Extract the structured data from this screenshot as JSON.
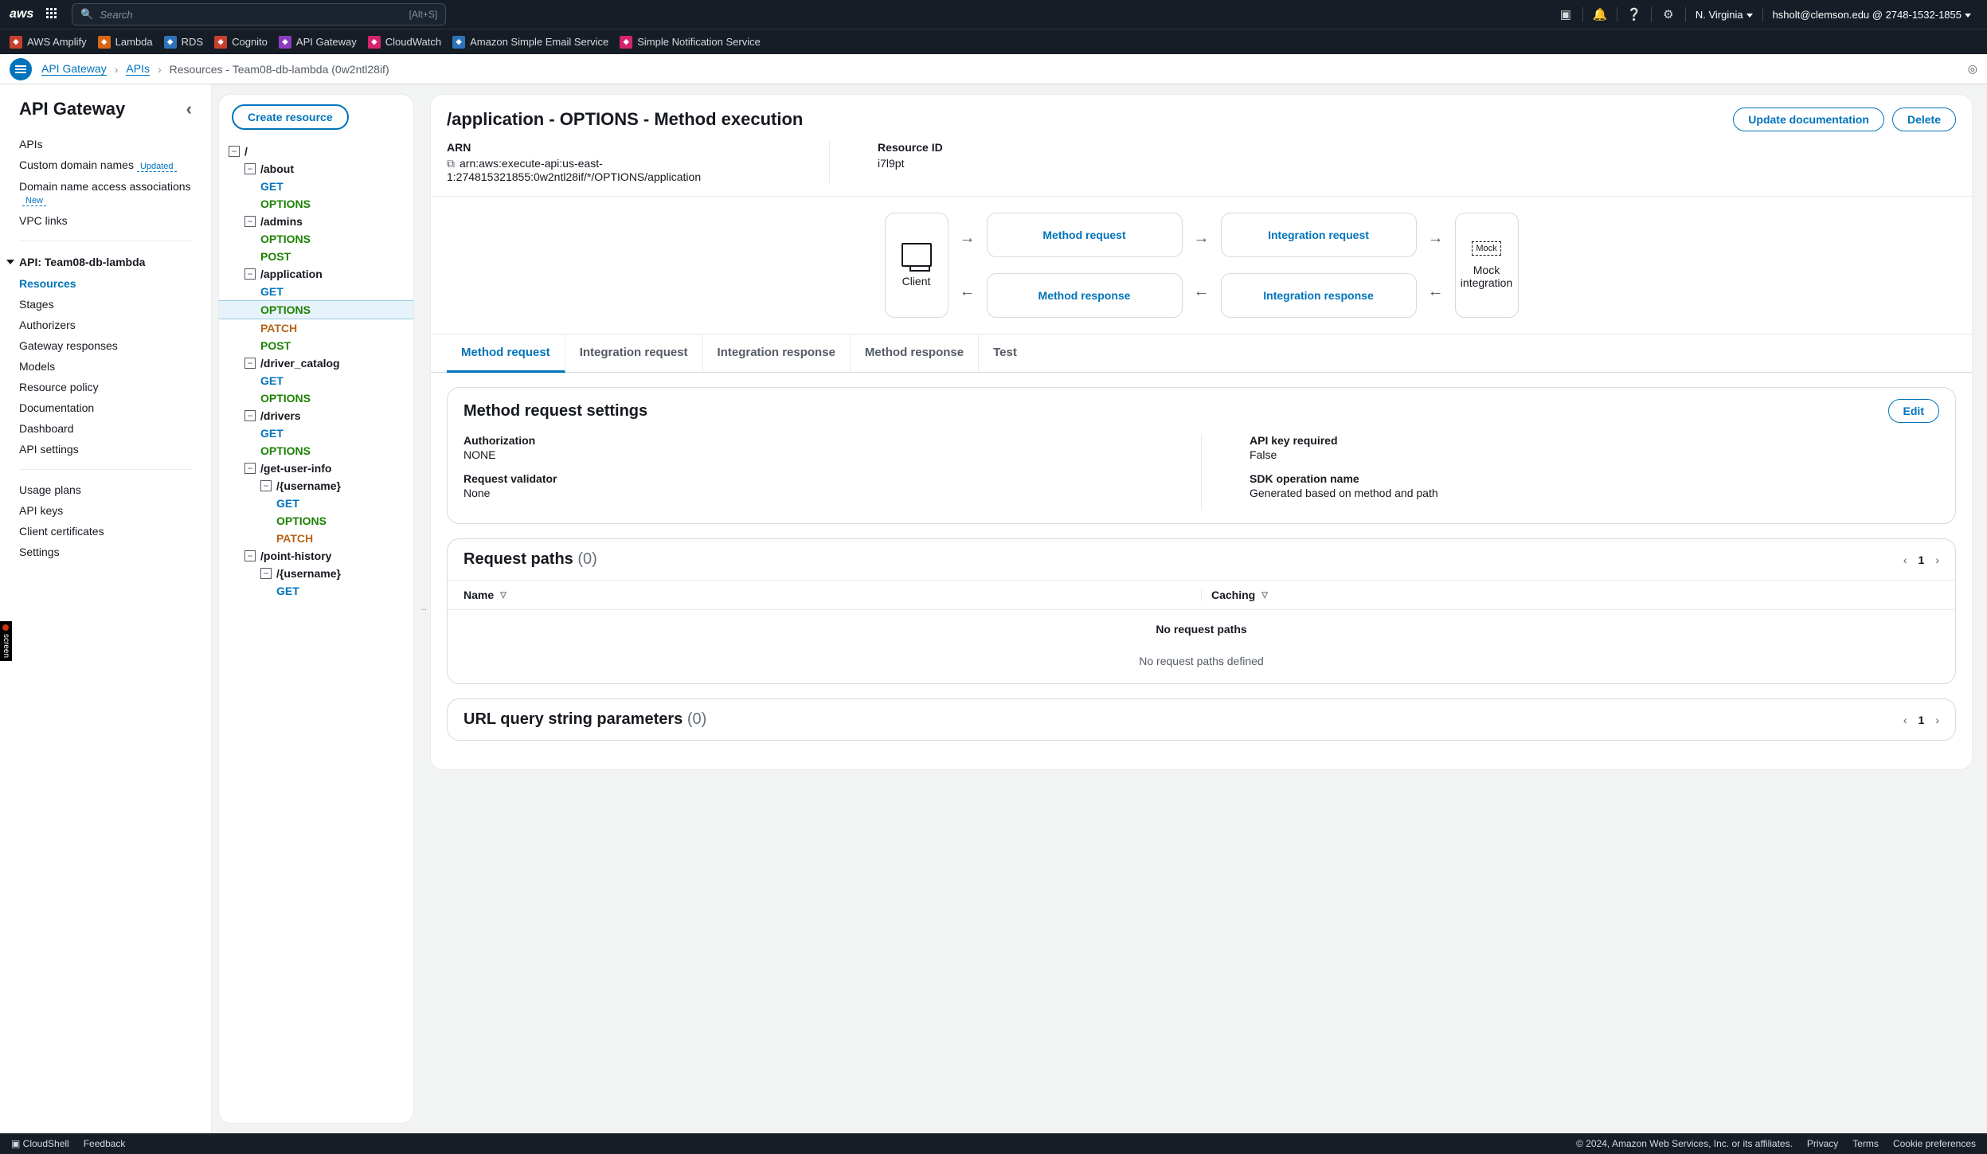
{
  "header": {
    "logo": "aws",
    "search_placeholder": "Search",
    "search_shortcut": "[Alt+S]",
    "region": "N. Virginia",
    "account": "hsholt@clemson.edu @ 2748-1532-1855"
  },
  "services": [
    {
      "name": "AWS Amplify",
      "color": "#c7402f"
    },
    {
      "name": "Lambda",
      "color": "#d86613"
    },
    {
      "name": "RDS",
      "color": "#2e73b8"
    },
    {
      "name": "Cognito",
      "color": "#c7402f"
    },
    {
      "name": "API Gateway",
      "color": "#8a3ebf"
    },
    {
      "name": "CloudWatch",
      "color": "#d6246c"
    },
    {
      "name": "Amazon Simple Email Service",
      "color": "#2e73b8"
    },
    {
      "name": "Simple Notification Service",
      "color": "#d6246c"
    }
  ],
  "breadcrumb": {
    "items": [
      "API Gateway",
      "APIs",
      "Resources - Team08-db-lambda (0w2ntl28if)"
    ]
  },
  "sidebar": {
    "title": "API Gateway",
    "top": [
      {
        "label": "APIs"
      },
      {
        "label": "Custom domain names",
        "badge": "Updated",
        "badgeClass": "upd"
      },
      {
        "label": "Domain name access associations",
        "badge": "New",
        "badgeClass": "new"
      },
      {
        "label": "VPC links"
      }
    ],
    "api_header": "API: Team08-db-lambda",
    "api_items": [
      {
        "label": "Resources",
        "active": true
      },
      {
        "label": "Stages"
      },
      {
        "label": "Authorizers"
      },
      {
        "label": "Gateway responses"
      },
      {
        "label": "Models"
      },
      {
        "label": "Resource policy"
      },
      {
        "label": "Documentation"
      },
      {
        "label": "Dashboard"
      },
      {
        "label": "API settings"
      }
    ],
    "bottom": [
      {
        "label": "Usage plans"
      },
      {
        "label": "API keys"
      },
      {
        "label": "Client certificates"
      },
      {
        "label": "Settings"
      }
    ]
  },
  "tree": {
    "create_label": "Create resource",
    "rows": [
      {
        "ind": 0,
        "tog": "−",
        "text": "/",
        "cls": "res"
      },
      {
        "ind": 1,
        "tog": "−",
        "text": "/about",
        "cls": "res"
      },
      {
        "ind": 2,
        "text": "GET",
        "cls": "m-get"
      },
      {
        "ind": 2,
        "text": "OPTIONS",
        "cls": "m-opt"
      },
      {
        "ind": 1,
        "tog": "−",
        "text": "/admins",
        "cls": "res"
      },
      {
        "ind": 2,
        "text": "OPTIONS",
        "cls": "m-opt"
      },
      {
        "ind": 2,
        "text": "POST",
        "cls": "m-post"
      },
      {
        "ind": 1,
        "tog": "−",
        "text": "/application",
        "cls": "res"
      },
      {
        "ind": 2,
        "text": "GET",
        "cls": "m-get"
      },
      {
        "ind": 2,
        "text": "OPTIONS",
        "cls": "m-opt",
        "sel": true
      },
      {
        "ind": 2,
        "text": "PATCH",
        "cls": "m-patch"
      },
      {
        "ind": 2,
        "text": "POST",
        "cls": "m-post"
      },
      {
        "ind": 1,
        "tog": "−",
        "text": "/driver_catalog",
        "cls": "res"
      },
      {
        "ind": 2,
        "text": "GET",
        "cls": "m-get"
      },
      {
        "ind": 2,
        "text": "OPTIONS",
        "cls": "m-opt"
      },
      {
        "ind": 1,
        "tog": "−",
        "text": "/drivers",
        "cls": "res"
      },
      {
        "ind": 2,
        "text": "GET",
        "cls": "m-get"
      },
      {
        "ind": 2,
        "text": "OPTIONS",
        "cls": "m-opt"
      },
      {
        "ind": 1,
        "tog": "−",
        "text": "/get-user-info",
        "cls": "res"
      },
      {
        "ind": 2,
        "tog": "−",
        "text": "/{username}",
        "cls": "res"
      },
      {
        "ind": 3,
        "text": "GET",
        "cls": "m-get"
      },
      {
        "ind": 3,
        "text": "OPTIONS",
        "cls": "m-opt"
      },
      {
        "ind": 3,
        "text": "PATCH",
        "cls": "m-patch"
      },
      {
        "ind": 1,
        "tog": "−",
        "text": "/point-history",
        "cls": "res"
      },
      {
        "ind": 2,
        "tog": "−",
        "text": "/{username}",
        "cls": "res"
      },
      {
        "ind": 3,
        "text": "GET",
        "cls": "m-get"
      }
    ]
  },
  "page": {
    "title": "/application - OPTIONS - Method execution",
    "update_doc": "Update documentation",
    "delete": "Delete",
    "arn_label": "ARN",
    "arn_value": "arn:aws:execute-api:us-east-1:274815321855:0w2ntl28if/*/OPTIONS/application",
    "resid_label": "Resource ID",
    "resid_value": "i7l9pt",
    "flow": {
      "client": "Client",
      "method_request": "Method request",
      "integration_request": "Integration request",
      "method_response": "Method response",
      "integration_response": "Integration response",
      "mock": "Mock",
      "mock_label": "Mock integration"
    },
    "tabs": [
      "Method request",
      "Integration request",
      "Integration response",
      "Method response",
      "Test"
    ],
    "active_tab": 0,
    "settings": {
      "title": "Method request settings",
      "edit": "Edit",
      "auth_k": "Authorization",
      "auth_v": "NONE",
      "apikey_k": "API key required",
      "apikey_v": "False",
      "validator_k": "Request validator",
      "validator_v": "None",
      "sdk_k": "SDK operation name",
      "sdk_v": "Generated based on method and path"
    },
    "request_paths": {
      "title": "Request paths",
      "count": "(0)",
      "page": "1",
      "cols": [
        "Name",
        "Caching"
      ],
      "empty_title": "No request paths",
      "empty_sub": "No request paths defined"
    },
    "query_params": {
      "title": "URL query string parameters",
      "count": "(0)",
      "page": "1"
    }
  },
  "footer": {
    "cloudshell": "CloudShell",
    "feedback": "Feedback",
    "copyright": "© 2024, Amazon Web Services, Inc. or its affiliates.",
    "links": [
      "Privacy",
      "Terms",
      "Cookie preferences"
    ]
  },
  "rec": "screen"
}
